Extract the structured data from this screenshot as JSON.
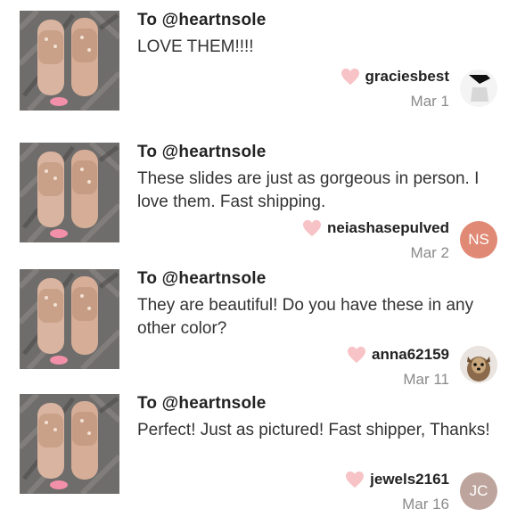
{
  "reviews": [
    {
      "to": "To @heartnsole",
      "message": "LOVE THEM!!!!",
      "username": "graciesbest",
      "date": "Mar 1",
      "avatar": {
        "type": "image",
        "icon": "shoe-sketch-avatar"
      }
    },
    {
      "to": "To @heartnsole",
      "message": "These slides are just as gorgeous in person. I love them. Fast shipping.",
      "username": "neiashasepulved",
      "date": "Mar 2",
      "avatar": {
        "type": "initials",
        "initials": "NS",
        "color": "#e08975"
      }
    },
    {
      "to": "To @heartnsole",
      "message": "They are beautiful! Do you have these in any other color?",
      "username": "anna62159",
      "date": "Mar 11",
      "avatar": {
        "type": "image",
        "icon": "dog-photo-avatar"
      }
    },
    {
      "to": "To @heartnsole",
      "message": "Perfect! Just as pictured! Fast shipper, Thanks!",
      "username": "jewels2161",
      "date": "Mar 16",
      "avatar": {
        "type": "initials",
        "initials": "JC",
        "color": "#bda49c"
      }
    }
  ],
  "colors": {
    "heart": "#f7c3c6",
    "date_text": "#8a8a8a",
    "slide": "#d9b4a0",
    "fur": "#6f6d6b"
  },
  "icons": {
    "heart": "heart-icon",
    "thumbnail": "rose-gold-slides-photo"
  }
}
